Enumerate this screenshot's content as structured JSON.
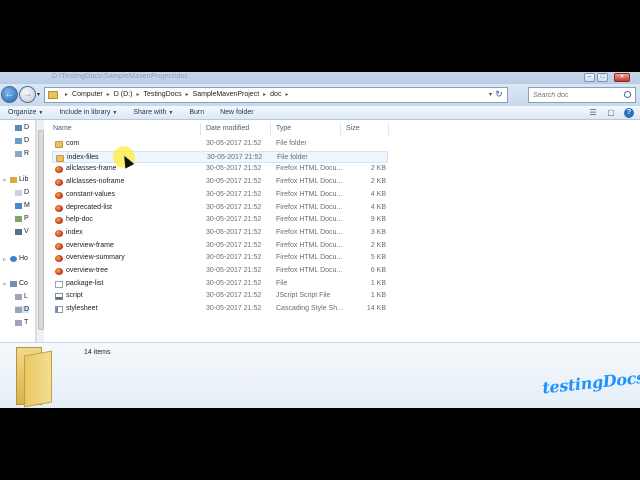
{
  "window": {
    "title": "D:\\TestingDocs\\SampleMavenProject\\doc"
  },
  "address": {
    "crumbs": [
      "Computer",
      "D (D:)",
      "TestingDocs",
      "SampleMavenProject",
      "doc"
    ],
    "search_placeholder": "Search doc"
  },
  "toolbar": {
    "organize": "Organize",
    "include_library": "Include in library",
    "share_with": "Share with",
    "burn": "Burn",
    "new_folder": "New folder"
  },
  "nav": {
    "items": [
      {
        "label": "D",
        "icon": "monitor-icon"
      },
      {
        "label": "D",
        "icon": "drive-icon"
      },
      {
        "label": "R",
        "icon": "recent-icon"
      },
      {
        "label": "Lib",
        "icon": "library-icon"
      },
      {
        "label": "D",
        "icon": "documents-icon"
      },
      {
        "label": "M",
        "icon": "music-icon"
      },
      {
        "label": "P",
        "icon": "pictures-icon"
      },
      {
        "label": "V",
        "icon": "videos-icon"
      },
      {
        "label": "Ho",
        "icon": "homegroup-icon"
      },
      {
        "label": "Co",
        "icon": "computer-icon"
      },
      {
        "label": "L",
        "icon": "local-disk-icon"
      },
      {
        "label": "D",
        "icon": "drive-d-icon"
      },
      {
        "label": "T",
        "icon": "drive-icon"
      }
    ]
  },
  "columns": {
    "name": "Name",
    "date": "Date modified",
    "type": "Type",
    "size": "Size"
  },
  "files": [
    {
      "name": "com",
      "date": "30-05-2017 21:52",
      "type": "File folder",
      "size": "",
      "icon": "folder-icon"
    },
    {
      "name": "index-files",
      "date": "30-05-2017 21:52",
      "type": "File folder",
      "size": "",
      "icon": "folder-icon"
    },
    {
      "name": "allclasses-frame",
      "date": "30-05-2017 21:52",
      "type": "Firefox HTML Docu...",
      "size": "2 KB",
      "icon": "firefox-html-icon"
    },
    {
      "name": "allclasses-noframe",
      "date": "30-05-2017 21:52",
      "type": "Firefox HTML Docu...",
      "size": "2 KB",
      "icon": "firefox-html-icon"
    },
    {
      "name": "constant-values",
      "date": "30-05-2017 21:52",
      "type": "Firefox HTML Docu...",
      "size": "4 KB",
      "icon": "firefox-html-icon"
    },
    {
      "name": "deprecated-list",
      "date": "30-05-2017 21:52",
      "type": "Firefox HTML Docu...",
      "size": "4 KB",
      "icon": "firefox-html-icon"
    },
    {
      "name": "help-doc",
      "date": "30-05-2017 21:52",
      "type": "Firefox HTML Docu...",
      "size": "9 KB",
      "icon": "firefox-html-icon"
    },
    {
      "name": "index",
      "date": "30-05-2017 21:52",
      "type": "Firefox HTML Docu...",
      "size": "3 KB",
      "icon": "firefox-html-icon"
    },
    {
      "name": "overview-frame",
      "date": "30-05-2017 21:52",
      "type": "Firefox HTML Docu...",
      "size": "2 KB",
      "icon": "firefox-html-icon"
    },
    {
      "name": "overview-summary",
      "date": "30-05-2017 21:52",
      "type": "Firefox HTML Docu...",
      "size": "5 KB",
      "icon": "firefox-html-icon"
    },
    {
      "name": "overview-tree",
      "date": "30-05-2017 21:52",
      "type": "Firefox HTML Docu...",
      "size": "6 KB",
      "icon": "firefox-html-icon"
    },
    {
      "name": "package-list",
      "date": "30-05-2017 21:52",
      "type": "File",
      "size": "1 KB",
      "icon": "file-icon"
    },
    {
      "name": "script",
      "date": "30-05-2017 21:52",
      "type": "JScript Script File",
      "size": "1 KB",
      "icon": "jscript-icon"
    },
    {
      "name": "stylesheet",
      "date": "30-05-2017 21:52",
      "type": "Cascading Style Sh...",
      "size": "14 KB",
      "icon": "css-icon"
    }
  ],
  "status": {
    "count": "14 items"
  },
  "watermark": "testingDocs.com"
}
